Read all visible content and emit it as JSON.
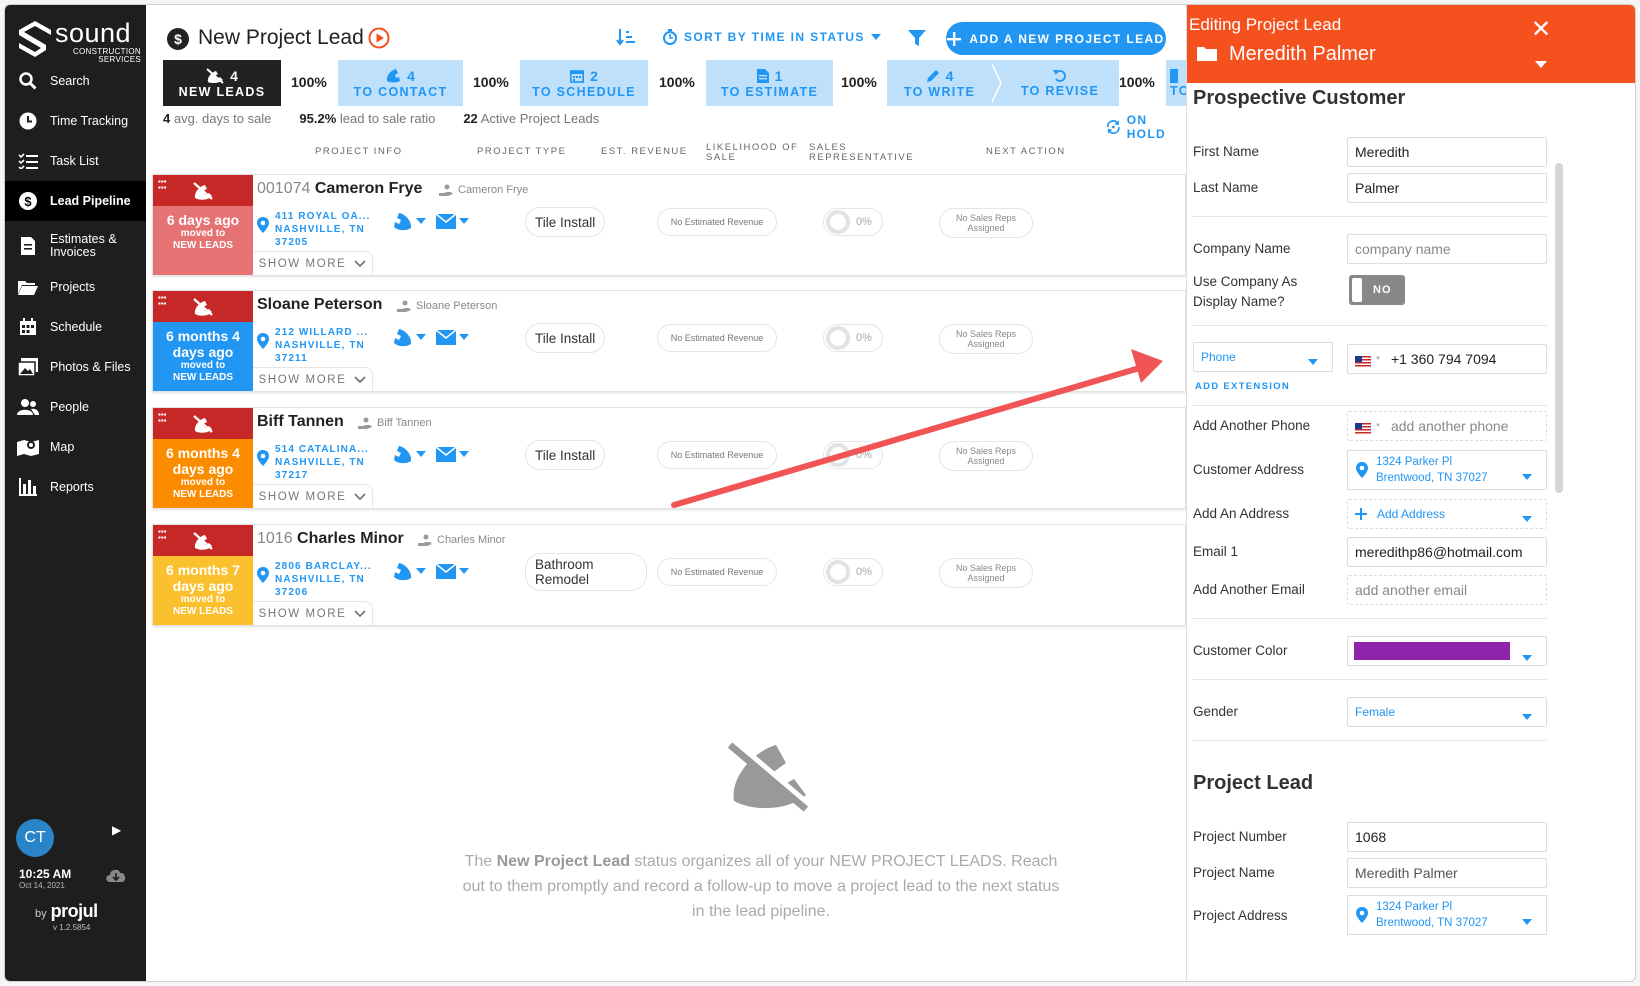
{
  "sidebar": {
    "logo_word": "sound",
    "logo_sub1": "CONSTRUCTION",
    "logo_sub2": "SERVICES",
    "items": [
      {
        "label": "Search"
      },
      {
        "label": "Time Tracking"
      },
      {
        "label": "Task List"
      },
      {
        "label": "Lead Pipeline"
      },
      {
        "label": "Estimates & Invoices"
      },
      {
        "label": "Projects"
      },
      {
        "label": "Schedule"
      },
      {
        "label": "Photos & Files"
      },
      {
        "label": "People"
      },
      {
        "label": "Map"
      },
      {
        "label": "Reports"
      }
    ],
    "avatar_initials": "CT",
    "time": "10:25 AM",
    "date": "Oct 14, 2021",
    "by": "by",
    "brand": "projul",
    "version": "v 1.2.5854"
  },
  "header": {
    "title": "New Project Lead",
    "sort_label": "SORT BY TIME IN STATUS",
    "add_button": "ADD A NEW PROJECT LEAD"
  },
  "stages": [
    {
      "count": "4",
      "name": "NEW LEADS"
    },
    {
      "pct": "100%"
    },
    {
      "count": "4",
      "name": "TO CONTACT"
    },
    {
      "pct": "100%"
    },
    {
      "count": "2",
      "name": "TO SCHEDULE"
    },
    {
      "pct": "100%"
    },
    {
      "count": "1",
      "name": "TO ESTIMATE"
    },
    {
      "pct": "100%"
    },
    {
      "count": "4",
      "name": "TO WRITE"
    },
    {
      "name": "TO REVISE"
    },
    {
      "pct": "100%"
    },
    {
      "name": "TO"
    }
  ],
  "stats": {
    "avg_days": "4",
    "avg_days_label": "avg. days to sale",
    "ratio": "95.2%",
    "ratio_label": "lead to sale ratio",
    "active": "22",
    "active_label": "Active Project Leads",
    "on_hold": "ON HOLD"
  },
  "columns": {
    "info": "PROJECT INFO",
    "type": "PROJECT TYPE",
    "revenue": "EST. REVENUE",
    "likelihood_1": "LIKELIHOOD OF",
    "likelihood_2": "SALE",
    "rep_1": "SALES",
    "rep_2": "REPRESENTATIVE",
    "next": "NEXT ACTION"
  },
  "leads": [
    {
      "number": "001074",
      "name": "Cameron Frye",
      "owner": "Cameron Frye",
      "ago": "6 days ago",
      "moved": "moved to",
      "stage": "NEW LEADS",
      "addr1": "411 ROYAL OA...",
      "addr2": "NASHVILLE, TN",
      "addr3": "37205",
      "type": "Tile Install",
      "revenue": "No Estimated Revenue",
      "likelihood": "0%",
      "rep1": "No Sales Reps",
      "rep2": "Assigned",
      "show_more": "SHOW MORE",
      "color": "#e57373",
      "top_color": "#c62828"
    },
    {
      "number": "",
      "name": "Sloane Peterson",
      "owner": "Sloane Peterson",
      "ago": "6 months 4 days ago",
      "moved": "moved to",
      "stage": "NEW LEADS",
      "addr1": "212 WILLARD ...",
      "addr2": "NASHVILLE, TN",
      "addr3": "37211",
      "type": "Tile Install",
      "revenue": "No Estimated Revenue",
      "likelihood": "0%",
      "rep1": "No Sales Reps",
      "rep2": "Assigned",
      "show_more": "SHOW MORE",
      "color": "#2196f3",
      "top_color": "#c62828"
    },
    {
      "number": "",
      "name": "Biff Tannen",
      "owner": "Biff Tannen",
      "ago": "6 months 4 days ago",
      "moved": "moved to",
      "stage": "NEW LEADS",
      "addr1": "514 CATALINA...",
      "addr2": "NASHVILLE, TN",
      "addr3": "37217",
      "type": "Tile Install",
      "revenue": "No Estimated Revenue",
      "likelihood": "0%",
      "rep1": "No Sales Reps",
      "rep2": "Assigned",
      "show_more": "SHOW MORE",
      "color": "#fb8c00",
      "top_color": "#c62828"
    },
    {
      "number": "1016",
      "name": "Charles Minor",
      "owner": "Charles Minor",
      "ago": "6 months 7 days ago",
      "moved": "moved to",
      "stage": "NEW LEADS",
      "addr1": "2806 BARCLAY...",
      "addr2": "NASHVILLE, TN",
      "addr3": "37206",
      "type": "Bathroom Remodel",
      "revenue": "No Estimated Revenue",
      "likelihood": "0%",
      "rep1": "No Sales Reps",
      "rep2": "Assigned",
      "show_more": "SHOW MORE",
      "color": "#fbc02d",
      "top_color": "#c62828"
    }
  ],
  "empty": {
    "pre": "The ",
    "bold": "New Project Lead",
    "post": " status organizes all of your NEW PROJECT LEADS. Reach out to them promptly and record a follow-up to move a project lead to the next status in the lead pipeline."
  },
  "panel": {
    "editing": "Editing Project Lead",
    "name": "Meredith Palmer",
    "section1": "Prospective Customer",
    "first_name_label": "First Name",
    "first_name": "Meredith",
    "last_name_label": "Last Name",
    "last_name": "Palmer",
    "company_label": "Company Name",
    "company_ph": "company name",
    "use_company_label1": "Use Company As",
    "use_company_label2": "Display Name?",
    "toggle": "NO",
    "phone_type": "Phone",
    "phone": "+1 360 794 7094",
    "add_extension": "ADD EXTENSION",
    "add_phone_label": "Add Another Phone",
    "add_phone_ph": "add another phone",
    "address_label": "Customer Address",
    "address1": "1324 Parker Pl",
    "address2": "Brentwood, TN 37027",
    "add_address_label": "Add An Address",
    "add_address": "Add Address",
    "email_label": "Email 1",
    "email": "meredithp86@hotmail.com",
    "add_email_label": "Add Another Email",
    "add_email_ph": "add another email",
    "color_label": "Customer Color",
    "customer_color": "#8e24aa",
    "gender_label": "Gender",
    "gender": "Female",
    "section2": "Project Lead",
    "project_number_label": "Project Number",
    "project_number": "1068",
    "project_name_label": "Project Name",
    "project_name": "Meredith Palmer",
    "project_address_label": "Project Address",
    "project_address1": "1324 Parker Pl",
    "project_address2": "Brentwood, TN 37027"
  },
  "colors": {
    "accent": "#2196f3",
    "panel_head": "#f4511e",
    "annotation_arrow": "#f05454"
  }
}
